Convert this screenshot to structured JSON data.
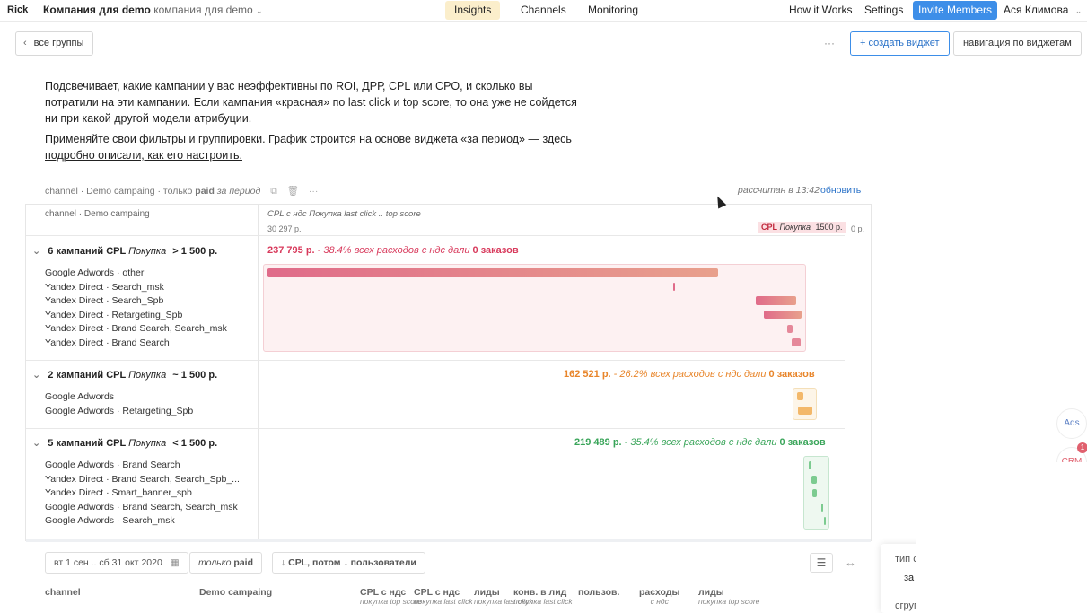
{
  "topbar": {
    "brand": "Rick",
    "company_bold": "Компания для demo",
    "company_sub": "компания для demo",
    "tabs": [
      "Insights",
      "Channels",
      "Monitoring"
    ],
    "right_links": [
      "How it Works",
      "Settings"
    ],
    "invite": "Invite Members",
    "user": "Ася Климова"
  },
  "toolbar": {
    "back": "все группы",
    "more": "···",
    "create": "+ создать виджет",
    "nav": "навигация по виджетам"
  },
  "description": {
    "p1": "Подсвечивает, какие кампании у вас неэффективны по ROI, ДРР, CPL или CPO, и сколько вы потратили на эти кампании. Если кампания «красная» по last click и top score, то она уже не сойдется ни при какой другой модели атрибуции.",
    "p2_text": "Применяйте свои фильтры и группировки. График строится на основе виджета «за период» —",
    "p2_link": "здесь подробно описали, как его настроить."
  },
  "widget_meta": {
    "title_plain": "channel · Demo campaing · только",
    "title_bold": "paid",
    "title_italic": "за период",
    "calculated": "рассчитан в 13:42",
    "refresh": "обновить"
  },
  "table": {
    "left_header": "channel · Demo campaing",
    "right_header": "CPL с ндс Покупка last click .. top score",
    "scale_left": "30 297 р.",
    "cpl_tag_label": "CPL",
    "cpl_tag_event": "Покупка",
    "cpl_tag_value": "1500 р.",
    "scale_right": "0 р.",
    "groups": [
      {
        "count_label": "6 кампаний CPL",
        "event": "Покупка",
        "cond": "> 1 500 р.",
        "summary_value": "237 795 р.",
        "summary_pct": "- 38.4% всех расходов",
        "summary_mid": "с ндс дали",
        "summary_orders": "0 заказов",
        "color": "#d83a5c",
        "campaigns": [
          "Google Adwords · other",
          "Yandex Direct · Search_msk",
          "Yandex Direct · Search_Spb",
          "Yandex Direct · Retargeting_Spb",
          "Yandex Direct · Brand Search, Search_msk",
          "Yandex Direct · Brand Search"
        ]
      },
      {
        "count_label": "2 кампаний CPL",
        "event": "Покупка",
        "cond": "~ 1 500 р.",
        "summary_value": "162 521 р.",
        "summary_pct": "- 26.2% всех расходов",
        "summary_mid": "с ндс дали",
        "summary_orders": "0 заказов",
        "color": "#e8852a",
        "campaigns": [
          "Google Adwords",
          "Google Adwords · Retargeting_Spb"
        ]
      },
      {
        "count_label": "5 кампаний CPL",
        "event": "Покупка",
        "cond": "< 1 500 р.",
        "summary_value": "219 489 р.",
        "summary_pct": "- 35.4% всех расходов",
        "summary_mid": "с ндс дали",
        "summary_orders": "0 заказов",
        "color": "#3aa55a",
        "campaigns": [
          "Google Adwords · Brand Search",
          "Yandex Direct · Brand Search, Search_Spb_...",
          "Yandex Direct · Smart_banner_spb",
          "Google Adwords · Brand Search, Search_msk",
          "Google Adwords · Search_msk"
        ]
      }
    ]
  },
  "filters": {
    "date": "вт 1 сен .. сб 31 окт 2020",
    "only": "только",
    "paid": "paid",
    "sort": "↓ CPL, потом ↓ пользователи",
    "expand": "↔"
  },
  "columns": [
    {
      "label": "channel",
      "sub": ""
    },
    {
      "label": "Demo campaing",
      "sub": ""
    },
    {
      "label": "CPL с ндс",
      "sub": "покупка top score"
    },
    {
      "label": "CPL с ндс",
      "sub": "покупка last click"
    },
    {
      "label": "лиды",
      "sub": "покупка last click"
    },
    {
      "label": "конв. в лид",
      "sub": "покупка last click"
    },
    {
      "label": "пользов.",
      "sub": ""
    },
    {
      "label": "расходы",
      "sub": "с ндс"
    },
    {
      "label": "лиды",
      "sub": "покупка top score"
    }
  ],
  "side": {
    "ads": "Ads",
    "crm": "CRM",
    "crm_badge": "1",
    "popup_type": "тип с",
    "popup_period": "за п",
    "popup_group": "сгруппиров."
  },
  "colors": {
    "accent": "#3d8ee8",
    "active_tab": "#fbeecb",
    "red": "#d83a5c",
    "orange": "#e8852a",
    "green": "#3aa55a"
  }
}
